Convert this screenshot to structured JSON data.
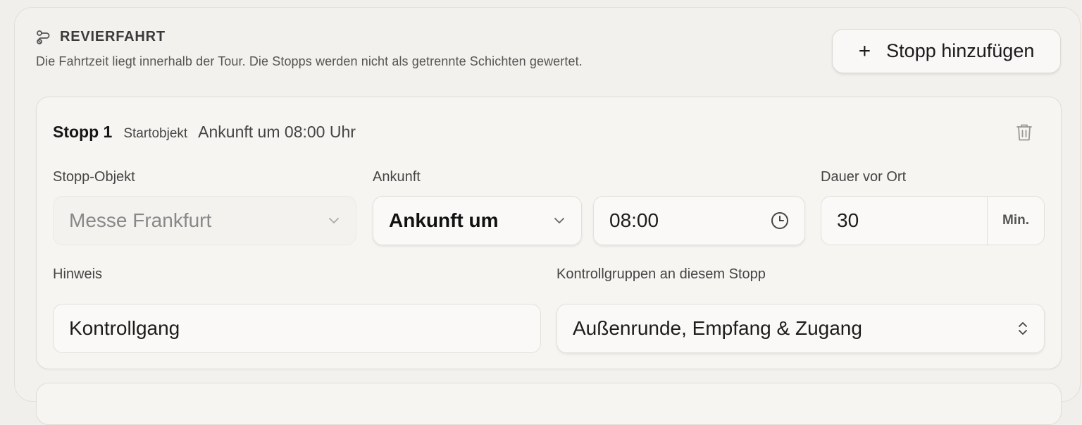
{
  "section": {
    "title": "REVIERFAHRT",
    "description": "Die Fahrtzeit liegt innerhalb der Tour. Die Stopps werden nicht als getrennte Schichten gewertet.",
    "icon": "route-icon"
  },
  "add_button": {
    "label": "Stopp hinzufügen",
    "icon": "plus-icon"
  },
  "stop": {
    "title": "Stopp 1",
    "badge": "Startobjekt",
    "arrival_summary": "Ankunft um 08:00 Uhr",
    "fields": {
      "object_label": "Stopp-Objekt",
      "object_value": "Messe Frankfurt",
      "arrival_label": "Ankunft",
      "arrival_mode": "Ankunft um",
      "arrival_time": "08:00",
      "duration_label": "Dauer vor Ort",
      "duration_value": "30",
      "duration_unit": "Min.",
      "note_label": "Hinweis",
      "note_value": "Kontrollgang",
      "groups_label": "Kontrollgruppen an diesem Stopp",
      "groups_value": "Außenrunde, Empfang & Zugang"
    }
  }
}
